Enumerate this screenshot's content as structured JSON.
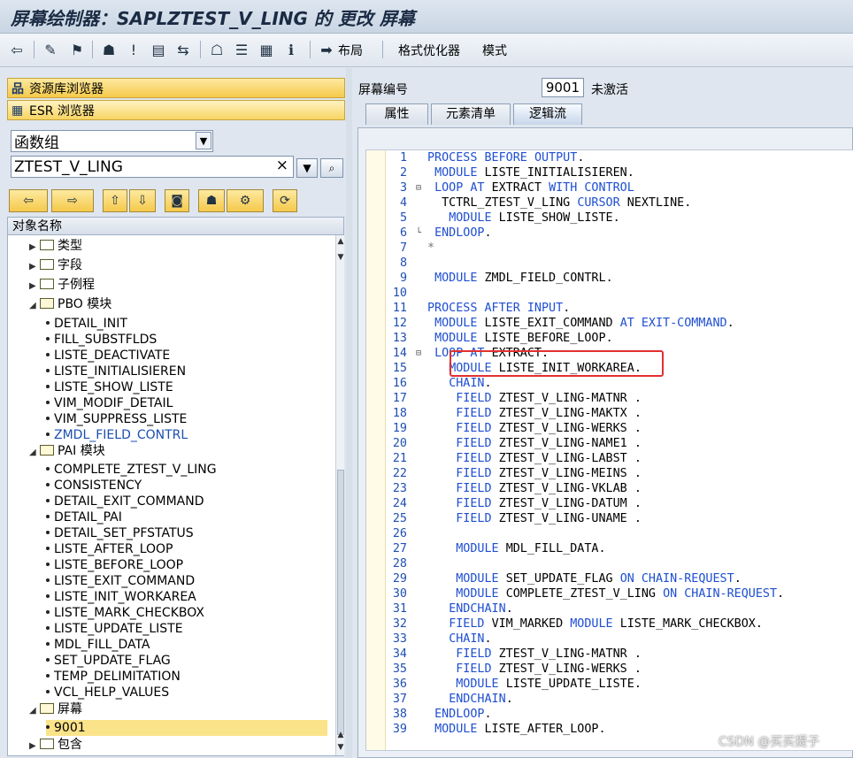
{
  "window": {
    "title": "屏幕绘制器：SAPLZTEST_V_LING 的 更改 屏幕"
  },
  "toolbar": {
    "layout_label": "布局",
    "format_optimizer_label": "格式优化器",
    "mode_label": "模式"
  },
  "left": {
    "repo_browser_label": "资源库浏览器",
    "esr_browser_label": "ESR 浏览器",
    "object_type": "函数组",
    "object_name": "ZTEST_V_LING",
    "tree_header": "对象名称",
    "folders": {
      "types": "类型",
      "fields": "字段",
      "subroutines": "子例程",
      "pbo": "PBO 模块",
      "pai": "PAI 模块",
      "screens": "屏幕",
      "includes": "包含"
    },
    "pbo_modules": [
      "DETAIL_INIT",
      "FILL_SUBSTFLDS",
      "LISTE_DEACTIVATE",
      "LISTE_INITIALISIEREN",
      "LISTE_SHOW_LISTE",
      "VIM_MODIF_DETAIL",
      "VIM_SUPPRESS_LISTE",
      "ZMDL_FIELD_CONTRL"
    ],
    "pai_modules": [
      "COMPLETE_ZTEST_V_LING",
      "CONSISTENCY",
      "DETAIL_EXIT_COMMAND",
      "DETAIL_PAI",
      "DETAIL_SET_PFSTATUS",
      "LISTE_AFTER_LOOP",
      "LISTE_BEFORE_LOOP",
      "LISTE_EXIT_COMMAND",
      "LISTE_INIT_WORKAREA",
      "LISTE_MARK_CHECKBOX",
      "LISTE_UPDATE_LISTE",
      "MDL_FILL_DATA",
      "SET_UPDATE_FLAG",
      "TEMP_DELIMITATION",
      "VCL_HELP_VALUES"
    ],
    "screens": [
      "9001"
    ]
  },
  "right": {
    "screen_number_label": "屏幕编号",
    "screen_number": "9001",
    "screen_status": "未激活",
    "tabs": [
      "属性",
      "元素清单",
      "逻辑流"
    ],
    "code_lines": [
      "PROCESS BEFORE OUTPUT.",
      " MODULE LISTE_INITIALISIEREN.",
      " LOOP AT EXTRACT WITH CONTROL",
      "  TCTRL_ZTEST_V_LING CURSOR NEXTLINE.",
      "   MODULE LISTE_SHOW_LISTE.",
      " ENDLOOP.",
      "*",
      "",
      " MODULE ZMDL_FIELD_CONTRL.",
      "",
      "PROCESS AFTER INPUT.",
      " MODULE LISTE_EXIT_COMMAND AT EXIT-COMMAND.",
      " MODULE LISTE_BEFORE_LOOP.",
      " LOOP AT EXTRACT.",
      "   MODULE LISTE_INIT_WORKAREA.",
      "   CHAIN.",
      "    FIELD ZTEST_V_LING-MATNR .",
      "    FIELD ZTEST_V_LING-MAKTX .",
      "    FIELD ZTEST_V_LING-WERKS .",
      "    FIELD ZTEST_V_LING-NAME1 .",
      "    FIELD ZTEST_V_LING-LABST .",
      "    FIELD ZTEST_V_LING-MEINS .",
      "    FIELD ZTEST_V_LING-VKLAB .",
      "    FIELD ZTEST_V_LING-DATUM .",
      "    FIELD ZTEST_V_LING-UNAME .",
      "",
      "    MODULE MDL_FILL_DATA.",
      "",
      "    MODULE SET_UPDATE_FLAG ON CHAIN-REQUEST.",
      "    MODULE COMPLETE_ZTEST_V_LING ON CHAIN-REQUEST.",
      "   ENDCHAIN.",
      "   FIELD VIM_MARKED MODULE LISTE_MARK_CHECKBOX.",
      "   CHAIN.",
      "    FIELD ZTEST_V_LING-MATNR .",
      "    FIELD ZTEST_V_LING-WERKS .",
      "    MODULE LISTE_UPDATE_LISTE.",
      "   ENDCHAIN.",
      " ENDLOOP.",
      " MODULE LISTE_AFTER_LOOP."
    ]
  },
  "watermark": "CSDN @买买提子"
}
